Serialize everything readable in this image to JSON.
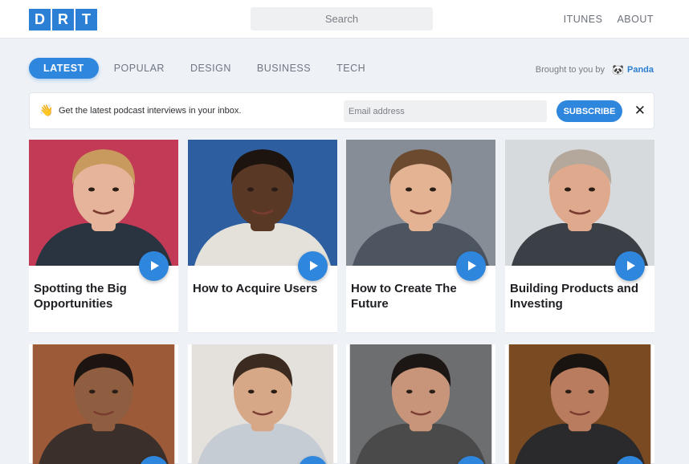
{
  "header": {
    "logo_letters": [
      "D",
      "R",
      "T"
    ],
    "search_placeholder": "Search",
    "nav": [
      "ITUNES",
      "ABOUT"
    ]
  },
  "tabs": [
    "LATEST",
    "POPULAR",
    "DESIGN",
    "BUSINESS",
    "TECH"
  ],
  "active_tab": "LATEST",
  "sponsor": {
    "text": "Brought to you by",
    "icon": "panda-icon",
    "brand": "Panda"
  },
  "newsletter": {
    "icon": "waving-hand-icon",
    "text": "Get the latest podcast interviews in your inbox.",
    "email_placeholder": "Email address",
    "button": "SUBSCRIBE",
    "close_icon": "close-icon"
  },
  "colors": {
    "accent": "#2f86dd",
    "logo": "#2b7fd4",
    "background": "#eef1f6"
  },
  "episodes": [
    {
      "title": "Spotting the Big Opportunities",
      "photo_bg": "#c23a55",
      "skin": "#e6b49a",
      "hair": "#c99a5e",
      "shirt": "#2a3440"
    },
    {
      "title": "How to Acquire Users",
      "photo_bg": "#2d5fa0",
      "skin": "#5a3826",
      "hair": "#1d1410",
      "shirt": "#e4e1db"
    },
    {
      "title": "How to Create The Future",
      "photo_bg": "#878d96",
      "skin": "#e3b394",
      "hair": "#6b4a30",
      "shirt": "#4c5560"
    },
    {
      "title": "Building Products and Investing",
      "photo_bg": "#d7dadd",
      "skin": "#dfa98d",
      "hair": "#b3a89b",
      "shirt": "#3b3f46"
    },
    {
      "title": "",
      "photo_bg": "#9c5a38",
      "skin": "#8f5d40",
      "hair": "#1b1410",
      "shirt": "#3a2f2a"
    },
    {
      "title": "",
      "photo_bg": "#e4e1dd",
      "skin": "#d7a887",
      "hair": "#3a2a20",
      "shirt": "#c6ccd4"
    },
    {
      "title": "",
      "photo_bg": "#6d6e70",
      "skin": "#c8957a",
      "hair": "#1c1714",
      "shirt": "#4a4a4a"
    },
    {
      "title": "",
      "photo_bg": "#7a4a22",
      "skin": "#b97c5e",
      "hair": "#1a1410",
      "shirt": "#2a2a2c"
    }
  ]
}
